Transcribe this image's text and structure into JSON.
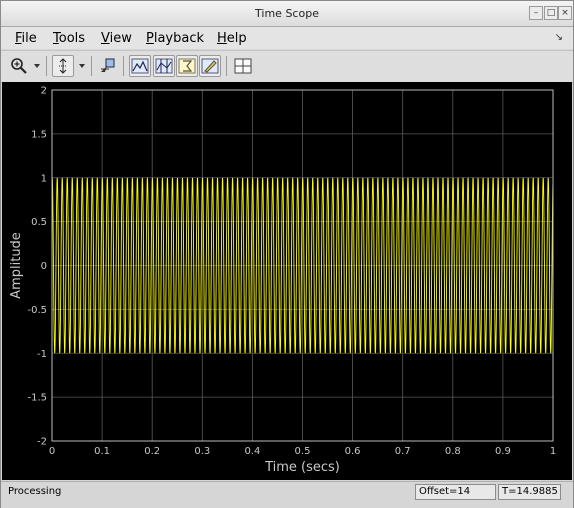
{
  "window": {
    "title": "Time Scope"
  },
  "menu": [
    {
      "label": "File",
      "mnemonic": "F",
      "rest": "ile"
    },
    {
      "label": "Tools",
      "mnemonic": "T",
      "rest": "ools"
    },
    {
      "label": "View",
      "mnemonic": "V",
      "rest": "iew"
    },
    {
      "label": "Playback",
      "mnemonic": "P",
      "rest": "layback"
    },
    {
      "label": "Help",
      "mnemonic": "H",
      "rest": "elp"
    }
  ],
  "toolbar": {
    "icons": [
      "zoom-icon",
      "autoscale-icon",
      "highlight-simulink-icon",
      "triggers-icon",
      "cursor-measurements-icon",
      "signal-statistics-icon",
      "peak-finder-icon",
      "layout-icon"
    ]
  },
  "colors": {
    "plot_bg": "#000000",
    "grid": "#5a5a5a",
    "signal": "#ffff00",
    "axis_text": "#c8c8c8"
  },
  "chart_data": {
    "type": "line",
    "title": "",
    "xlabel": "Time (secs)",
    "ylabel": "Amplitude",
    "xlim": [
      0,
      1
    ],
    "ylim": [
      -2,
      2
    ],
    "x_ticks": [
      "0",
      "0.1",
      "0.2",
      "0.3",
      "0.4",
      "0.5",
      "0.6",
      "0.7",
      "0.8",
      "0.9",
      "1"
    ],
    "y_ticks": [
      "2",
      "1.5",
      "1",
      "0.5",
      "0",
      "-0.5",
      "-1",
      "-1.5",
      "-2"
    ],
    "grid": true,
    "series": [
      {
        "amplitude": 1,
        "frequency_hz": 100,
        "color": "#ffff00"
      }
    ]
  },
  "status": {
    "text": "Processing",
    "offset": "Offset=14",
    "time": "T=14.9885"
  }
}
